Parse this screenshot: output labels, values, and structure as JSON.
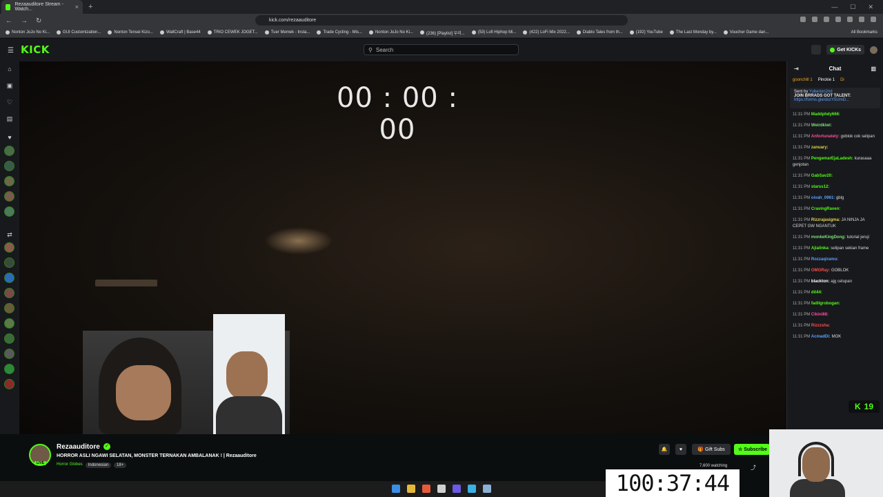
{
  "browser": {
    "tab_title": "Rezaauditore Stream - Watch...",
    "tab_close": "×",
    "new_tab": "+",
    "url": "kick.com/rezaauditore",
    "bookmarks": [
      "Nonton JoJo No Ki...",
      "GUI Customization...",
      "Nonton Tensei Kizo...",
      "WallCraft | Base44",
      "TRIO CEWEK JOGET...",
      "Tuer Memek - Insta...",
      "Trade Cycling - Mis...",
      "Nonton JoJo No Ki...",
      "(236) [Playlist] 우리...",
      "(53) Lofi Hiphop Mi...",
      "(422) LoFi Mix 2022...",
      "Diablo Tales from th...",
      "(192) YouTube",
      "The Last Monday by...",
      "Voucher Game dan..."
    ],
    "all_bookmarks": "All Bookmarks"
  },
  "header": {
    "logo": "KICK",
    "search_placeholder": "Search",
    "get_kicks": "Get KICKs"
  },
  "video": {
    "overlay_timer": "00 : 00 : 00"
  },
  "chat": {
    "title": "Chat",
    "gifters": [
      {
        "name": "goonchill",
        "count": "1",
        "color": "#f5a623"
      },
      {
        "name": "Pinckie",
        "count": "1",
        "color": "#ffffff"
      },
      {
        "name": "Di",
        "count": "",
        "color": "#f5a623"
      }
    ],
    "pinned": {
      "sent_by_label": "Sent by",
      "sender": "Yuberion2nd",
      "text": "JOIN BRRADS GOT TALENT:",
      "link": "https://forms.gle/dozY5UmD..."
    },
    "messages": [
      {
        "time": "11:31 PM",
        "user": "Maddphdy666:",
        "color": "#53fc18",
        "text": ""
      },
      {
        "time": "11:31 PM",
        "user": "Weirdkiwi:",
        "color": "#7be37b",
        "text": ""
      },
      {
        "time": "11:31 PM",
        "user": "Anfortunately:",
        "color": "#ff4d9e",
        "text": "goblok cok selipan"
      },
      {
        "time": "11:31 PM",
        "user": "zanuary:",
        "color": "#e0d54b",
        "text": ""
      },
      {
        "time": "11:31 PM",
        "user": "PengemarEjaLadesh:",
        "color": "#53fc18",
        "text": "kurasaaa genjotan"
      },
      {
        "time": "11:31 PM",
        "user": "GabSav20:",
        "color": "#53fc18",
        "text": ""
      },
      {
        "time": "11:31 PM",
        "user": "starss12:",
        "color": "#53fc18",
        "text": ""
      },
      {
        "time": "11:31 PM",
        "user": "oivah_0961:",
        "color": "#5aa0ff",
        "text": "gblg"
      },
      {
        "time": "11:31 PM",
        "user": "CravingRaven:",
        "color": "#53fc18",
        "text": ""
      },
      {
        "time": "11:31 PM",
        "user": "Rizzrajasigma:",
        "color": "#e0d54b",
        "text": "JA NINJA JA CEPET GW NGANTUK"
      },
      {
        "time": "11:31 PM",
        "user": "monkeKingDong:",
        "color": "#7be37b",
        "text": "tutorial jeruji"
      },
      {
        "time": "11:31 PM",
        "user": "Ajialinka:",
        "color": "#53fc18",
        "text": "selipan sekian frame"
      },
      {
        "time": "11:31 PM",
        "user": "Rozzaqiramu:",
        "color": "#5aa0ff",
        "text": ""
      },
      {
        "time": "11:31 PM",
        "user": "OMGRay:",
        "color": "#ff4d4d",
        "text": "GOBLOK"
      },
      {
        "time": "11:31 PM",
        "user": "blackton:",
        "color": "#ffffff",
        "text": "ajg celupan"
      },
      {
        "time": "11:31 PM",
        "user": "dit44:",
        "color": "#53fc18",
        "text": ""
      },
      {
        "time": "11:31 PM",
        "user": "fadilgrobogan:",
        "color": "#53fc18",
        "text": ""
      },
      {
        "time": "11:31 PM",
        "user": "Cikini88:",
        "color": "#ff4d9e",
        "text": ""
      },
      {
        "time": "11:31 PM",
        "user": "Rizzzsha:",
        "color": "#ff4d4d",
        "text": ""
      },
      {
        "time": "11:31 PM",
        "user": "AcmadDi:",
        "color": "#5aa0ff",
        "text": "MOK"
      }
    ],
    "viewer_badge": "19"
  },
  "channel": {
    "name": "Rezaauditore",
    "live_label": "LIVE",
    "title": "HORROR ASLI NGAWI SELATAN, MONSTER TERNAKAN AMBALANAK ! | Rezaauditore",
    "category": "Horror Globes",
    "tags": [
      "Indonesian",
      "18+"
    ],
    "gift_subs": "Gift Subs",
    "subscribe": "Subscribe",
    "watching": "7,600 watching"
  },
  "overlay": {
    "big_timer": "100:37:44"
  },
  "colors": {
    "brand": "#53fc18",
    "background": "#0b0e0f",
    "panel": "#18191c"
  }
}
